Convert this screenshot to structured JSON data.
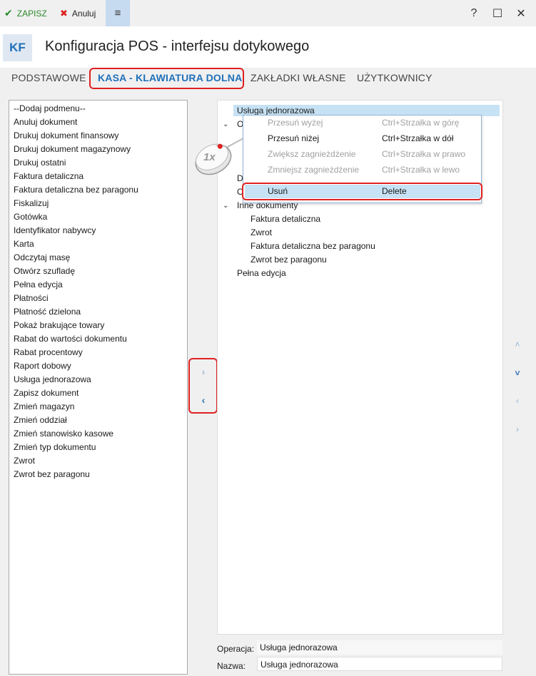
{
  "toolbar": {
    "save_label": "ZAPISZ",
    "cancel_label": "Anuluj",
    "menu_icon": "≡",
    "help_icon": "?",
    "maximize_icon": "☐",
    "close_icon": "✕",
    "save_icon": "✔",
    "cancel_icon": "✖"
  },
  "header": {
    "badge": "KF",
    "title": "Konfiguracja POS - interfejsu dotykowego"
  },
  "tabs": [
    {
      "label": "PODSTAWOWE"
    },
    {
      "label": "KASA - KLAWIATURA DOLNA"
    },
    {
      "label": "ZAKŁADKI WŁASNE"
    },
    {
      "label": "UŻYTKOWNICY"
    }
  ],
  "left_list": [
    "--Dodaj podmenu--",
    "Anuluj dokument",
    "Drukuj dokument finansowy",
    "Drukuj dokument magazynowy",
    "Drukuj ostatni",
    "Faktura detaliczna",
    "Faktura detaliczna bez paragonu",
    "Fiskalizuj",
    "Gotówka",
    "Identyfikator nabywcy",
    "Karta",
    "Odczytaj masę",
    "Otwórz szufladę",
    "Pełna edycja",
    "Płatności",
    "Płatność dzielona",
    "Pokaż brakujące towary",
    "Rabat do wartości dokumentu",
    "Rabat procentowy",
    "Raport dobowy",
    "Usługa jednorazowa",
    "Zapisz dokument",
    "Zmień magazyn",
    "Zmień oddział",
    "Zmień stanowisko kasowe",
    "Zmień typ dokumentu",
    "Zwrot",
    "Zwrot bez paragonu"
  ],
  "middle_buttons": {
    "add": "›",
    "remove": "‹"
  },
  "tree": {
    "selected": "Usługa jednorazowa",
    "partial_1": "O",
    "partial_2": "D",
    "partial_3": "O",
    "group": "Inne dokumenty",
    "children": [
      "Faktura detaliczna",
      "Zwrot",
      "Faktura detaliczna bez paragonu",
      "Zwrot bez paragonu"
    ],
    "last": "Pełna edycja"
  },
  "context_menu": [
    {
      "label": "Przesuń wyżej",
      "shortcut": "Ctrl+Strzałka w górę"
    },
    {
      "label": "Przesuń niżej",
      "shortcut": "Ctrl+Strzałka w dół"
    },
    {
      "label": "Zwiększ zagnieżdżenie",
      "shortcut": "Ctrl+Strzałka w prawo"
    },
    {
      "label": "Zmniejsz zagnieżdżenie",
      "shortcut": "Ctrl+Strzałka w lewo"
    },
    {
      "label": "Usuń",
      "shortcut": "Delete"
    }
  ],
  "mouse_hint": "1x",
  "right_buttons": {
    "up": "˄",
    "down": "˅",
    "left": "‹",
    "right": "›"
  },
  "fields": {
    "operation_label": "Operacja:",
    "operation_value": "Usługa jednorazowa",
    "name_label": "Nazwa:",
    "name_value": "Usługa jednorazowa"
  },
  "colors": {
    "accent": "#1f70b8",
    "highlight": "#e02020",
    "selection": "#c6e2f4"
  }
}
